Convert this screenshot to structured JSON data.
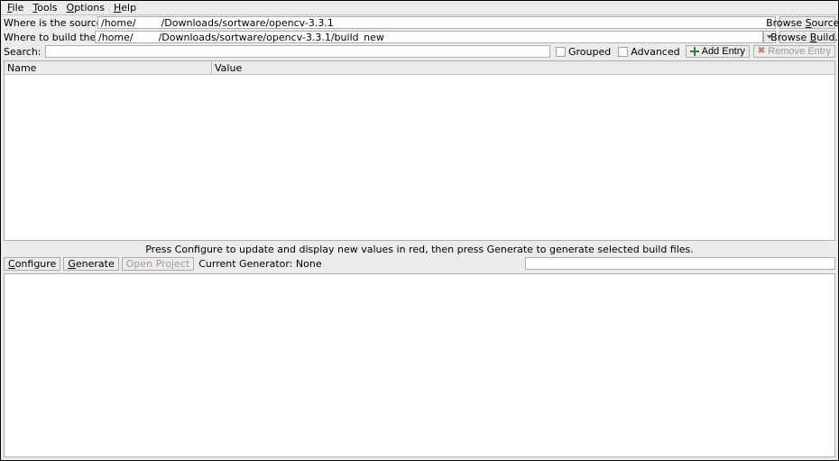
{
  "menu": {
    "file": "File",
    "tools": "Tools",
    "options": "Options",
    "help": "Help"
  },
  "labels": {
    "source": "Where is the source code:",
    "build": "Where to build the binaries:",
    "search": "Search:",
    "grouped": "Grouped",
    "advanced": "Advanced",
    "add_entry": "Add Entry",
    "remove_entry": "Remove Entry",
    "name_col": "Name",
    "value_col": "Value",
    "hint": "Press Configure to update and display new values in red, then press Generate to generate selected build files.",
    "configure": "Configure",
    "generate": "Generate",
    "open_project": "Open Project",
    "generator": "Current Generator: None",
    "browse_source": "Browse Source...",
    "browse_build": "Browse Build..."
  },
  "paths": {
    "source": "/home/        /Downloads/sortware/opencv-3.3.1",
    "build": "/home/        /Downloads/sortware/opencv-3.3.1/build_new"
  },
  "search_value": "",
  "checkboxes": {
    "grouped": false,
    "advanced": false
  }
}
